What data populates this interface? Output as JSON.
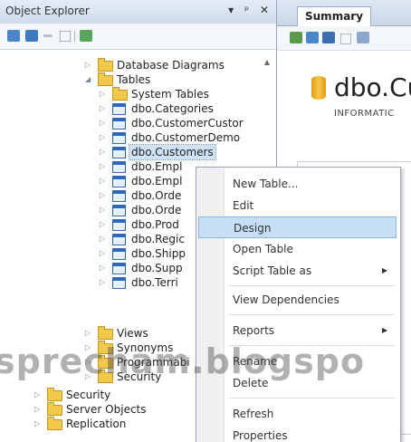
{
  "object_explorer": {
    "title": "Object Explorer",
    "header_buttons": [
      "▾",
      "ᵖ",
      "✕"
    ],
    "tree": [
      {
        "label": "Database Diagrams",
        "icon": "folder-icon",
        "expander": "collapsed"
      },
      {
        "label": "Tables",
        "icon": "folder-icon",
        "expander": "expanded"
      },
      {
        "label": "System Tables",
        "icon": "folder-icon",
        "expander": "collapsed"
      },
      {
        "label": "dbo.Categories",
        "icon": "table-icon",
        "expander": "collapsed"
      },
      {
        "label": "dbo.CustomerCustor",
        "icon": "table-icon",
        "expander": "collapsed"
      },
      {
        "label": "dbo.CustomerDemo",
        "icon": "table-icon",
        "expander": "collapsed"
      },
      {
        "label": "dbo.Customers",
        "icon": "table-icon",
        "expander": "collapsed",
        "selected": true
      },
      {
        "label": "dbo.Empl",
        "icon": "table-icon",
        "expander": "collapsed"
      },
      {
        "label": "dbo.Empl",
        "icon": "table-icon",
        "expander": "collapsed"
      },
      {
        "label": "dbo.Orde",
        "icon": "table-icon",
        "expander": "collapsed"
      },
      {
        "label": "dbo.Orde",
        "icon": "table-icon",
        "expander": "collapsed"
      },
      {
        "label": "dbo.Prod",
        "icon": "table-icon",
        "expander": "collapsed"
      },
      {
        "label": "dbo.Regic",
        "icon": "table-icon",
        "expander": "collapsed"
      },
      {
        "label": "dbo.Shipp",
        "icon": "table-icon",
        "expander": "collapsed"
      },
      {
        "label": "dbo.Supp",
        "icon": "table-icon",
        "expander": "collapsed"
      },
      {
        "label": "dbo.Terri",
        "icon": "table-icon",
        "expander": "collapsed"
      },
      {
        "label": "Views",
        "icon": "folder-icon",
        "expander": "collapsed"
      },
      {
        "label": "Synonyms",
        "icon": "folder-icon",
        "expander": "collapsed"
      },
      {
        "label": "Programmabi",
        "icon": "folder-icon",
        "expander": "collapsed"
      },
      {
        "label": "Security",
        "icon": "folder-icon",
        "expander": "collapsed"
      },
      {
        "label": "Security",
        "icon": "folder-icon",
        "expander": "collapsed"
      },
      {
        "label": "Server Objects",
        "icon": "folder-icon",
        "expander": "collapsed"
      },
      {
        "label": "Replication",
        "icon": "folder-icon",
        "expander": "collapsed"
      }
    ]
  },
  "summary": {
    "tab_label": "Summary",
    "heading": "dbo.Cu",
    "subheading": "INFORMATIC"
  },
  "context_menu": {
    "items": [
      {
        "label": "New Table...",
        "submenu": false
      },
      {
        "label": "Edit",
        "submenu": false
      },
      {
        "label": "Design",
        "submenu": false,
        "highlighted": true
      },
      {
        "label": "Open Table",
        "submenu": false
      },
      {
        "label": "Script Table as",
        "submenu": true
      },
      {
        "label": "View Dependencies",
        "submenu": false
      },
      {
        "label": "Reports",
        "submenu": true
      },
      {
        "label": "Rename",
        "submenu": false
      },
      {
        "label": "Delete",
        "submenu": false
      },
      {
        "label": "Refresh",
        "submenu": false
      },
      {
        "label": "Properties",
        "submenu": false
      }
    ]
  },
  "watermark": "sprecham.blogspo",
  "colors": {
    "menu_highlight": "#c6def6",
    "folder": "#f2c94c",
    "table": "#2d69b8",
    "header": "#cfdcec"
  }
}
